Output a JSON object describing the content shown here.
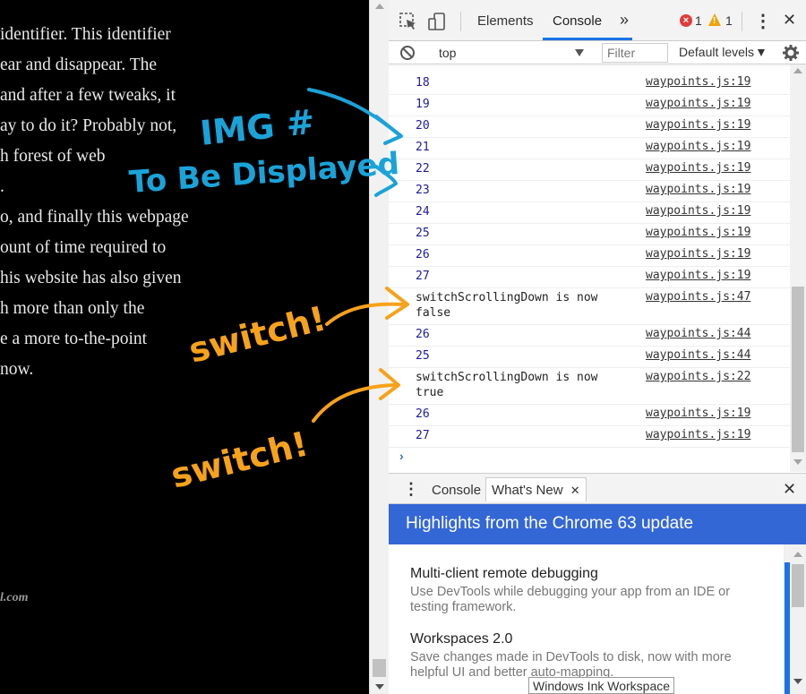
{
  "page": {
    "article_lines": [
      "identifier. This identifier",
      "ear and disappear. The",
      "and after a few tweaks, it",
      "ay to do it? Probably not,",
      "h forest of web",
      ".",
      "o, and finally this webpage",
      "ount of time required to",
      "his website has also given",
      "h more than only the",
      "e a more to-the-point",
      "now."
    ],
    "footer": "l.com"
  },
  "devtools": {
    "tabs": {
      "elements": "Elements",
      "console": "Console",
      "more": "»"
    },
    "errors": {
      "count": "1",
      "icon": "×"
    },
    "warnings": {
      "count": "1",
      "icon": "!"
    },
    "menu_icon": "⋮",
    "close_icon": "✕",
    "context": "top",
    "filter_placeholder": "Filter",
    "levels": "Default levels",
    "console_rows": [
      {
        "msg": "18",
        "src": "waypoints.js:19",
        "kind": "num"
      },
      {
        "msg": "19",
        "src": "waypoints.js:19",
        "kind": "num"
      },
      {
        "msg": "20",
        "src": "waypoints.js:19",
        "kind": "num"
      },
      {
        "msg": "21",
        "src": "waypoints.js:19",
        "kind": "num"
      },
      {
        "msg": "22",
        "src": "waypoints.js:19",
        "kind": "num"
      },
      {
        "msg": "23",
        "src": "waypoints.js:19",
        "kind": "num"
      },
      {
        "msg": "24",
        "src": "waypoints.js:19",
        "kind": "num"
      },
      {
        "msg": "25",
        "src": "waypoints.js:19",
        "kind": "num"
      },
      {
        "msg": "26",
        "src": "waypoints.js:19",
        "kind": "num"
      },
      {
        "msg": "27",
        "src": "waypoints.js:19",
        "kind": "num"
      },
      {
        "msg": "switchScrollingDown is now\nfalse",
        "src": "waypoints.js:47",
        "kind": "txt"
      },
      {
        "msg": "26",
        "src": "waypoints.js:44",
        "kind": "num"
      },
      {
        "msg": "25",
        "src": "waypoints.js:44",
        "kind": "num"
      },
      {
        "msg": "switchScrollingDown is now\ntrue",
        "src": "waypoints.js:22",
        "kind": "txt"
      },
      {
        "msg": "26",
        "src": "waypoints.js:19",
        "kind": "num"
      },
      {
        "msg": "27",
        "src": "waypoints.js:19",
        "kind": "num"
      }
    ],
    "prompt_symbol": "›",
    "drawer": {
      "menu_icon": "⋮",
      "tab_console": "Console",
      "tab_whats_new": "What's New",
      "tab_close": "✕",
      "close_icon": "✕"
    },
    "whats_new": {
      "banner": "Highlights from the Chrome 63 update",
      "features": [
        {
          "title": "Multi-client remote debugging",
          "desc": "Use DevTools while debugging your app from an IDE or testing framework."
        },
        {
          "title": "Workspaces 2.0",
          "desc": "Save changes made in DevTools to disk, now with more helpful UI and better auto-mapping."
        }
      ]
    }
  },
  "overlay": {
    "windows_ink_label": "Windows Ink Workspace",
    "annotation_img": "IMG #",
    "annotation_display": "To Be Displayed",
    "annotation_switch_1": "switch!",
    "annotation_switch_2": "switch!"
  },
  "colors": {
    "console_number": "#1a1aa6",
    "banner": "#3367d6",
    "annotation_blue": "#1aa3d9",
    "annotation_orange": "#f7a21b"
  }
}
